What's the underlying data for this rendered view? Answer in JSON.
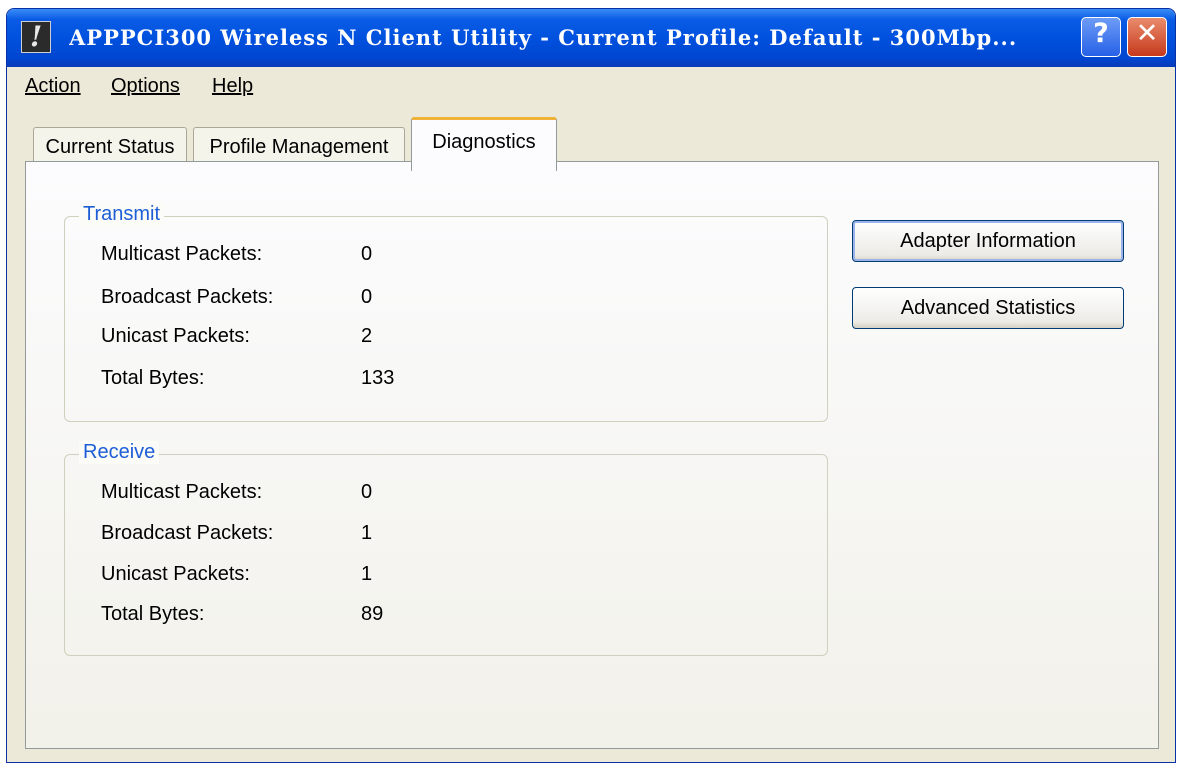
{
  "window": {
    "title": "APPPCI300 Wireless N Client Utility - Current Profile: Default - 300Mbp...",
    "help_glyph": "?",
    "close_glyph": "✕",
    "icon_glyph": "!"
  },
  "menu": [
    "Action",
    "Options",
    "Help"
  ],
  "tabs": [
    "Current Status",
    "Profile Management",
    "Diagnostics"
  ],
  "active_tab": "Diagnostics",
  "transmit": {
    "title": "Transmit",
    "rows": [
      {
        "label": "Multicast Packets:",
        "value": "0"
      },
      {
        "label": "Broadcast Packets:",
        "value": "0"
      },
      {
        "label": "Unicast Packets:",
        "value": "2"
      },
      {
        "label": "Total Bytes:",
        "value": "133"
      }
    ]
  },
  "receive": {
    "title": "Receive",
    "rows": [
      {
        "label": "Multicast Packets:",
        "value": "0"
      },
      {
        "label": "Broadcast Packets:",
        "value": "1"
      },
      {
        "label": "Unicast Packets:",
        "value": "1"
      },
      {
        "label": "Total Bytes:",
        "value": "89"
      }
    ]
  },
  "buttons": {
    "adapter_information": "Adapter Information",
    "advanced_statistics": "Advanced Statistics"
  }
}
